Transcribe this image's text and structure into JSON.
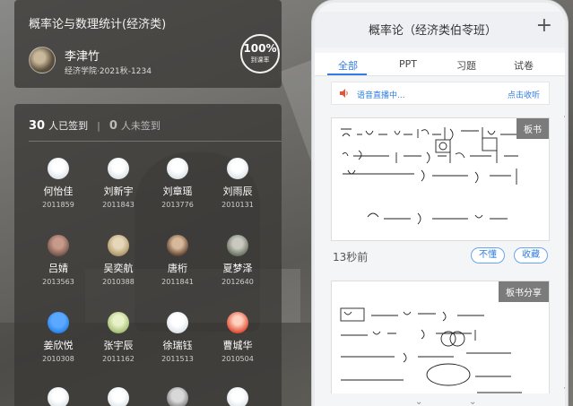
{
  "course": {
    "title": "概率论与数理统计(经济类)",
    "student_name": "李津竹",
    "student_meta": "经济学院·2021秋-1234",
    "rate_value": "100%",
    "rate_label": "到课率"
  },
  "signin": {
    "signed_count": "30",
    "signed_label": "人已签到",
    "unsigned_count": "0",
    "unsigned_label": "人未签到",
    "students": [
      {
        "name": "何怡佳",
        "id": "2011859",
        "avatar": "default"
      },
      {
        "name": "刘新宇",
        "id": "2011843",
        "avatar": "default"
      },
      {
        "name": "刘章瑶",
        "id": "2013776",
        "avatar": "default"
      },
      {
        "name": "刘雨辰",
        "id": "2010131",
        "avatar": "default"
      },
      {
        "name": "吕婧",
        "id": "2013563",
        "avatar": "photo"
      },
      {
        "name": "吴奕航",
        "id": "2010388",
        "avatar": "photo"
      },
      {
        "name": "唐桁",
        "id": "2011841",
        "avatar": "photo"
      },
      {
        "name": "夏梦泽",
        "id": "2012640",
        "avatar": "photo"
      },
      {
        "name": "姜欣悦",
        "id": "2010308",
        "avatar": "blue"
      },
      {
        "name": "张宇辰",
        "id": "2011162",
        "avatar": "green"
      },
      {
        "name": "徐瑞钰",
        "id": "2011513",
        "avatar": "default"
      },
      {
        "name": "曹城华",
        "id": "2010504",
        "avatar": "red"
      }
    ]
  },
  "phone": {
    "title": "概率论（经济类伯苓班）",
    "tabs": [
      "全部",
      "PPT",
      "习题",
      "试卷"
    ],
    "active_tab": "全部",
    "live_text": "语音直播中...",
    "live_link": "点击收听",
    "board1_tag": "板书",
    "board1_time": "13秒前",
    "btn_unclear": "不懂",
    "btn_favorite": "收藏",
    "board2_tag": "板书分享"
  },
  "colors": {
    "accent": "#2f7de1",
    "tag_bg": "#7b7b7b"
  }
}
